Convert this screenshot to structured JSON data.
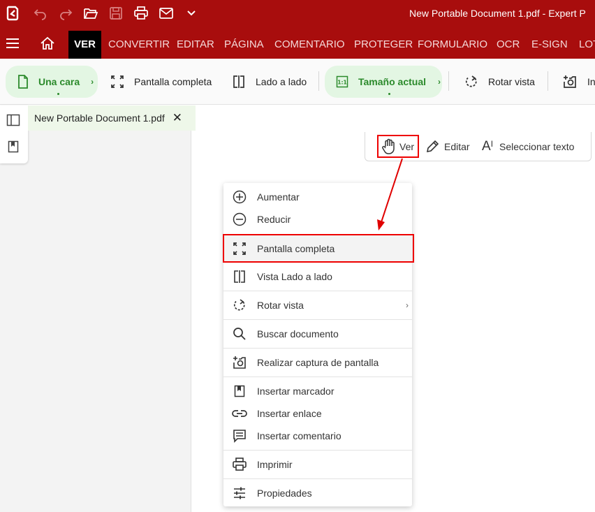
{
  "titlebar": {
    "title": "New Portable Document 1.pdf   -   Expert P",
    "icons": [
      "app-logo-icon",
      "undo-icon",
      "redo-icon",
      "open-folder-icon",
      "save-icon",
      "print-icon",
      "mail-icon",
      "dropdown-chevron-icon"
    ]
  },
  "menubar": {
    "tabs": [
      "VER",
      "CONVERTIR",
      "EDITAR",
      "PÁGINA",
      "COMENTARIO",
      "PROTEGER",
      "FORMULARIO",
      "OCR",
      "E-SIGN",
      "LOT"
    ],
    "active": "VER"
  },
  "ribbon": {
    "una_cara": "Una cara",
    "pantalla_completa": "Pantalla completa",
    "lado_a_lado": "Lado a lado",
    "tamano_actual": "Tamaño actual",
    "rotar_vista": "Rotar vista",
    "insertar": "In",
    "chevron": "›"
  },
  "document_tab": {
    "label": "New Portable Document 1.pdf",
    "close": "✕"
  },
  "tools": {
    "ver": "Ver",
    "editar": "Editar",
    "seleccionar": "Seleccionar texto",
    "select_glyph": "A"
  },
  "context_menu": {
    "items": [
      {
        "label": "Aumentar",
        "icon": "zoom-in-circle-icon"
      },
      {
        "label": "Reducir",
        "icon": "zoom-out-circle-icon"
      },
      {
        "label": "Pantalla completa",
        "icon": "fullscreen-icon",
        "highlighted": true
      },
      {
        "label": "Vista Lado a lado",
        "icon": "side-by-side-icon"
      },
      {
        "label": "Rotar vista",
        "icon": "rotate-icon",
        "has_submenu": true
      },
      {
        "label": "Buscar documento",
        "icon": "search-icon"
      },
      {
        "label": "Realizar captura de pantalla",
        "icon": "screenshot-icon"
      },
      {
        "label": "Insertar marcador",
        "icon": "bookmark-icon"
      },
      {
        "label": "Insertar enlace",
        "icon": "link-icon"
      },
      {
        "label": "Insertar comentario",
        "icon": "comment-icon"
      },
      {
        "label": "Imprimir",
        "icon": "print-icon"
      },
      {
        "label": "Propiedades",
        "icon": "properties-sliders-icon"
      }
    ],
    "submenu_glyph": "›"
  },
  "colors": {
    "brand_red": "#a80d0d",
    "accent_green": "#2b8a2b",
    "annotation_red": "#e00000"
  }
}
